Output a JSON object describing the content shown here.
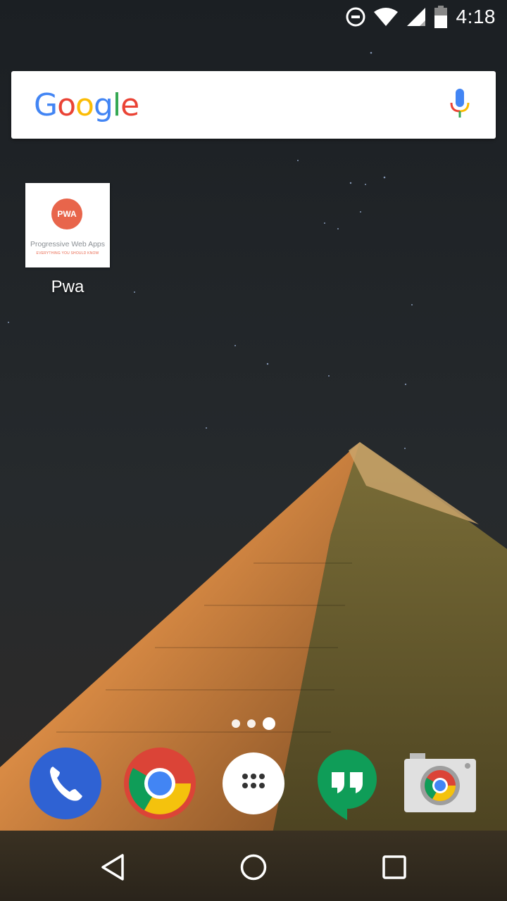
{
  "status_bar": {
    "time": "4:18",
    "icons": [
      "do-not-disturb-icon",
      "wifi-icon",
      "signal-icon",
      "battery-icon"
    ]
  },
  "search_bar": {
    "logo_letters": [
      {
        "char": "G",
        "color": "#4285F4"
      },
      {
        "char": "o",
        "color": "#EA4335"
      },
      {
        "char": "o",
        "color": "#FBBC05"
      },
      {
        "char": "g",
        "color": "#4285F4"
      },
      {
        "char": "l",
        "color": "#34A853"
      },
      {
        "char": "e",
        "color": "#EA4335"
      }
    ],
    "mic_icon": "mic-icon"
  },
  "home_apps": [
    {
      "label": "Pwa",
      "icon": {
        "badge": "PWA",
        "title": "Progressive Web Apps",
        "subtitle": "EVERYTHING YOU SHOULD KNOW",
        "accent": "#e8654b"
      }
    }
  ],
  "page_indicator": {
    "count": 3,
    "active_index": 2
  },
  "dock": [
    "phone-icon",
    "chrome-icon",
    "app-drawer-icon",
    "hangouts-icon",
    "camera-icon"
  ],
  "nav_bar": [
    "back-icon",
    "home-icon",
    "recents-icon"
  ],
  "colors": {
    "sky_top": "#1e2226",
    "sky_bottom": "#2e2b2a",
    "pyramid_lit": "#d9894a",
    "pyramid_shadow": "#5e5427"
  }
}
